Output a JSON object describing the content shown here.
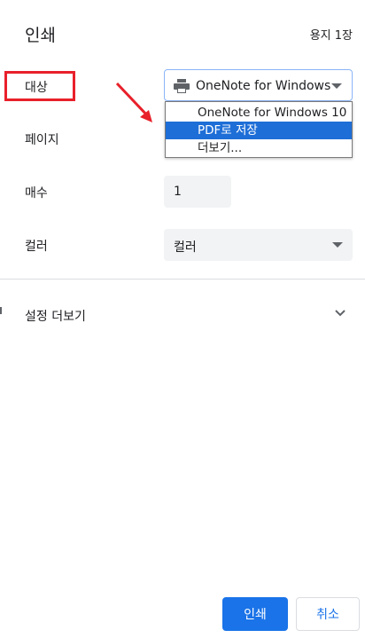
{
  "header": {
    "title": "인쇄",
    "sheet_count": "용지 1장"
  },
  "settings": {
    "destination_label": "대상",
    "pages_label": "페이지",
    "copies_label": "매수",
    "color_label": "컬러",
    "destination_value": "OneNote for Windows",
    "copies_value": "1",
    "color_value": "컬러",
    "more_settings_label": "설정 더보기"
  },
  "dropdown": {
    "options": [
      "OneNote for Windows 10",
      "PDF로 저장",
      "더보기..."
    ],
    "highlighted_index": 1
  },
  "buttons": {
    "print": "인쇄",
    "cancel": "취소"
  },
  "colors": {
    "primary_blue": "#1a73e8",
    "highlight_blue": "#1e6ed7",
    "annotation_red": "#e8202a"
  },
  "icons": [
    "printer-icon",
    "chevron-down-icon",
    "caret-down-icon",
    "arrow-annotation-icon"
  ]
}
